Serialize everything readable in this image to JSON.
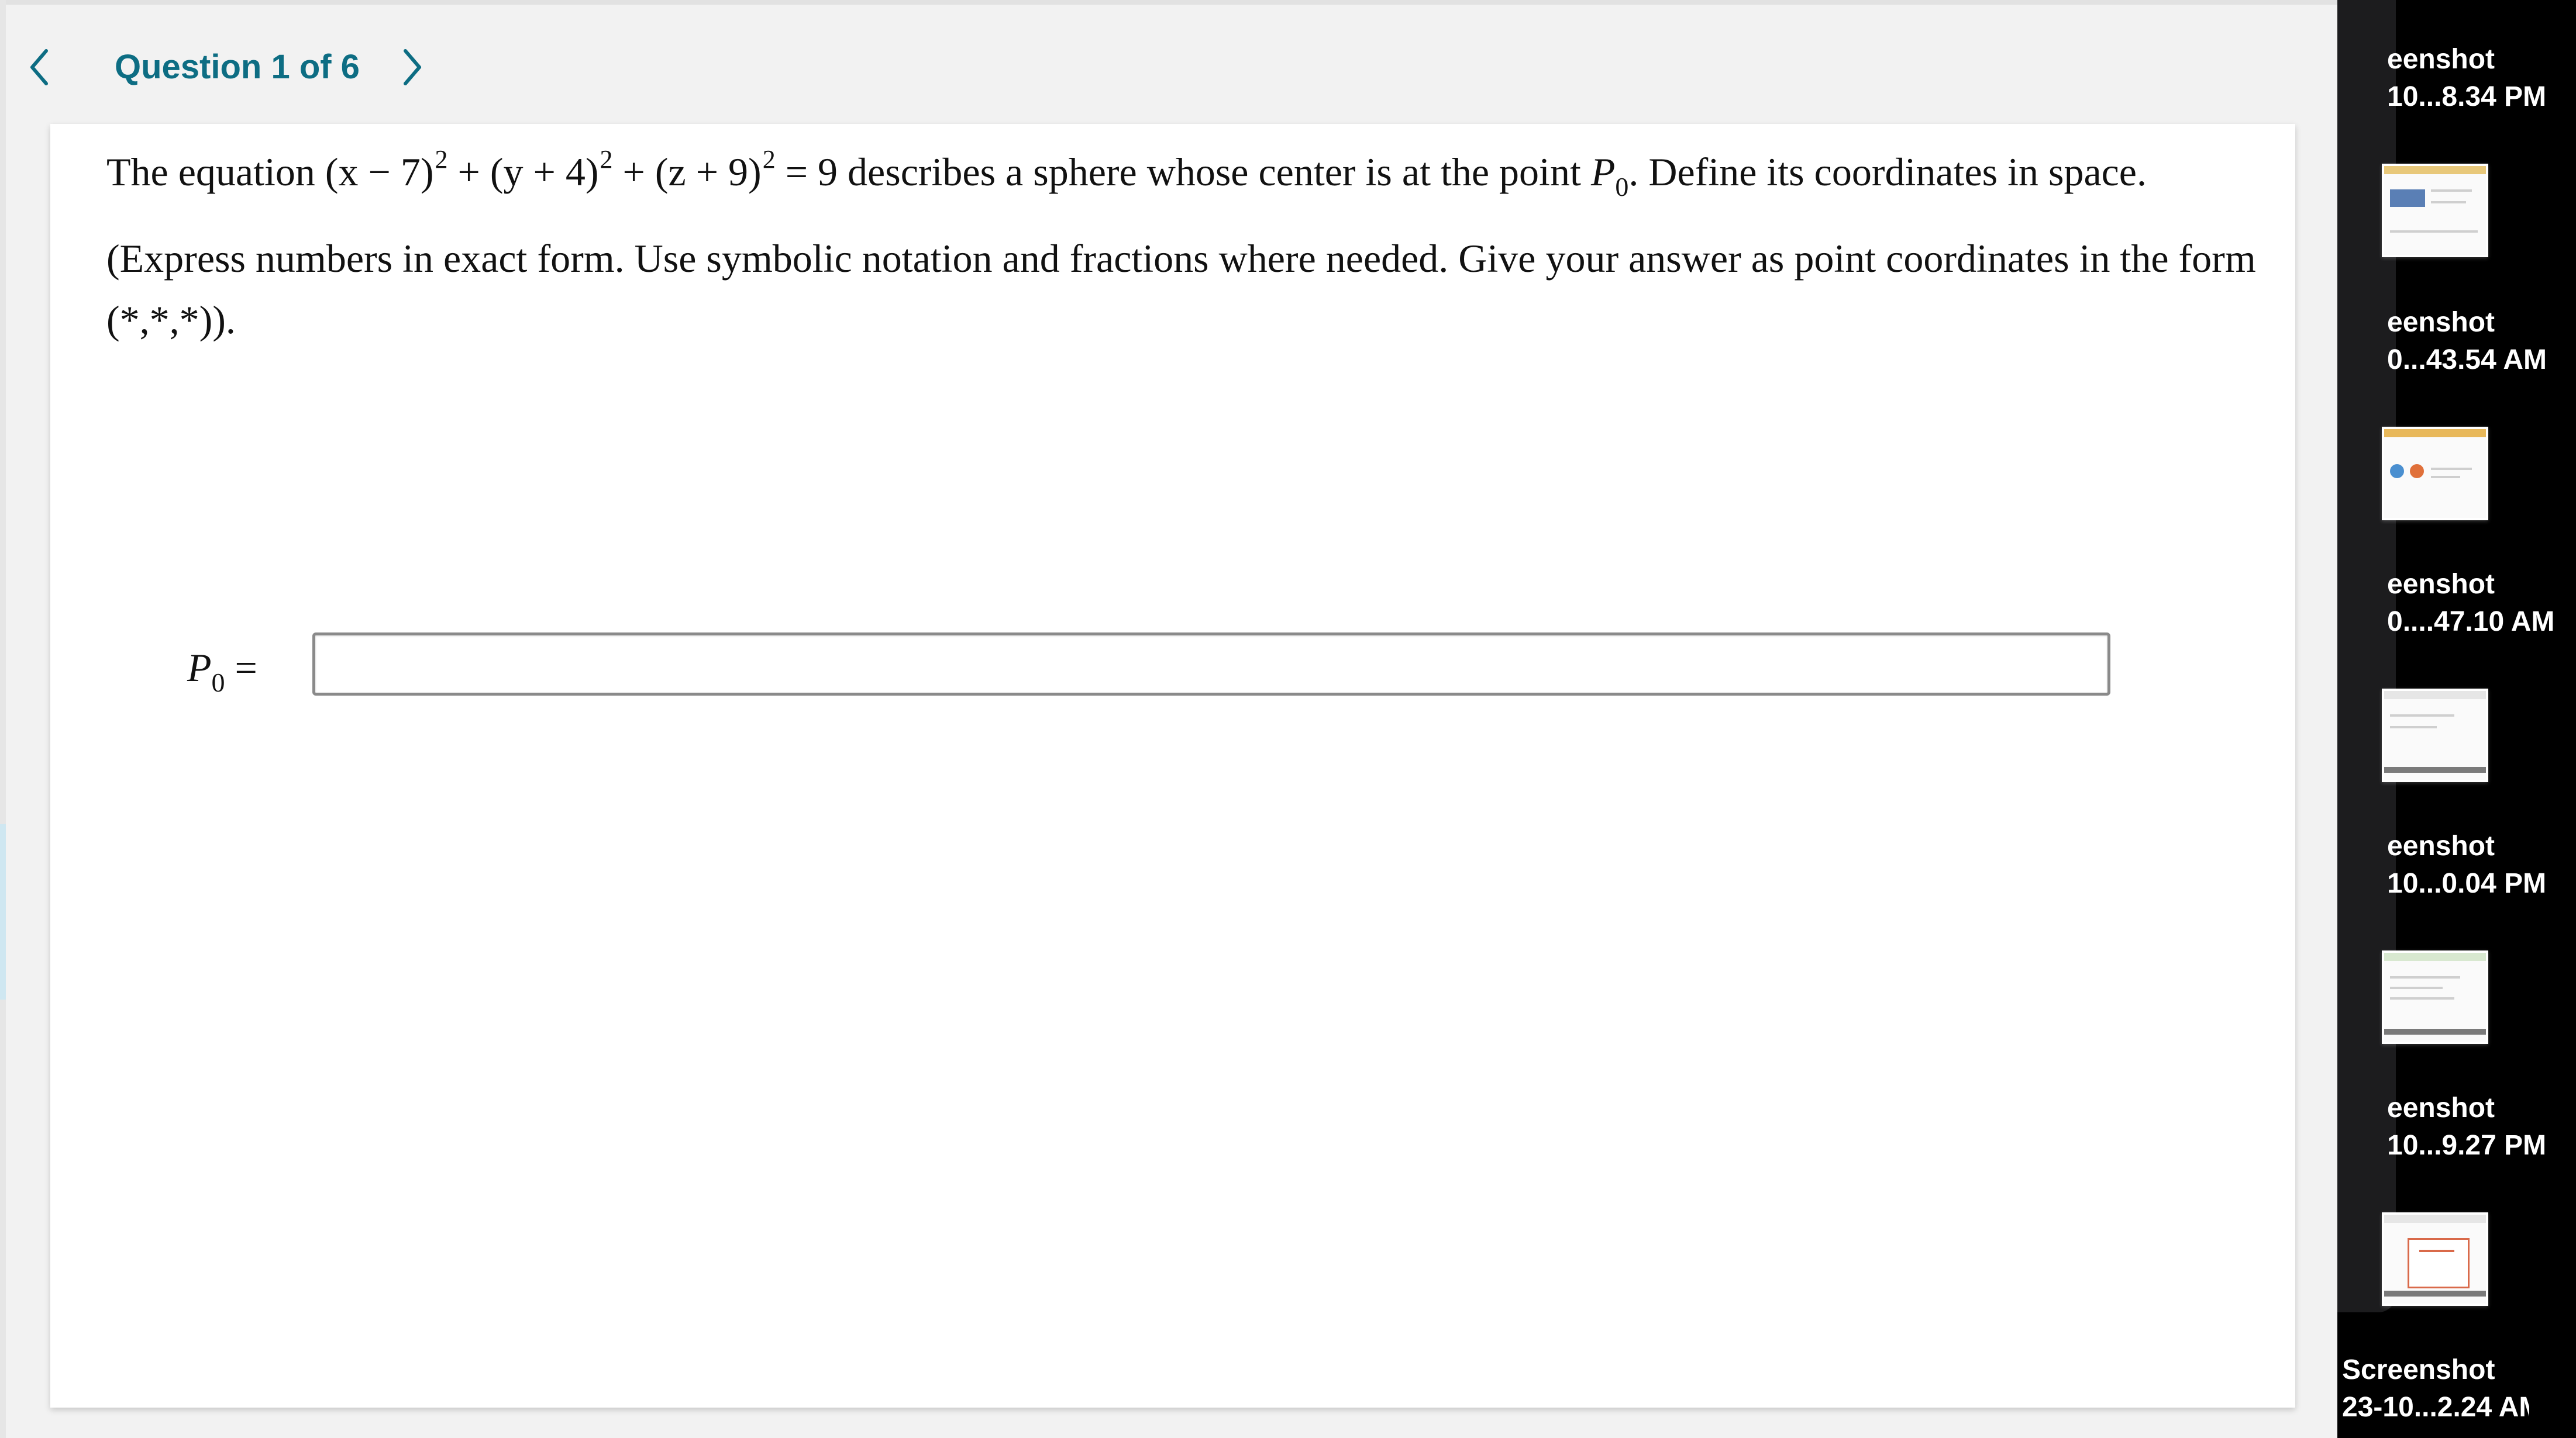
{
  "nav": {
    "title": "Question 1 of 6",
    "prev_icon": "chevron-left-icon",
    "next_icon": "chevron-right-icon"
  },
  "question": {
    "prompt_pre": "The equation ",
    "eq": {
      "t1": "(x − 7)",
      "t2": " + (y + 4)",
      "t3": " + (z + 9)",
      "exp": "2",
      "rhs": " = 9"
    },
    "prompt_mid": " describes a sphere whose center is at the point ",
    "point_symbol": "P",
    "point_sub": "0",
    "prompt_post": ". Define its coordinates in space.",
    "instructions": "(Express numbers in exact form. Use symbolic notation and fractions where needed. Give your answer as point coordinates in the form (*,*,*))."
  },
  "answer": {
    "label_symbol": "P",
    "label_sub": "0",
    "label_eq": " =",
    "value": "",
    "placeholder": ""
  },
  "dock": {
    "items": [
      {
        "line1": "eenshot",
        "line2": "10...8.34 PM"
      },
      {
        "line1": "eenshot",
        "line2": "0...43.54 AM"
      },
      {
        "line1": "eenshot",
        "line2": "0....47.10 AM"
      },
      {
        "line1": "eenshot",
        "line2": "10...0.04 PM"
      },
      {
        "line1": "eenshot",
        "line2": "10...9.27 PM"
      },
      {
        "line1": "Screenshot",
        "line2": "23-10...2.24 AM"
      }
    ]
  },
  "colors": {
    "accent": "#0d6d83",
    "page_bg": "#f2f2f2",
    "card_bg": "#ffffff",
    "dock_bg": "#000000"
  }
}
